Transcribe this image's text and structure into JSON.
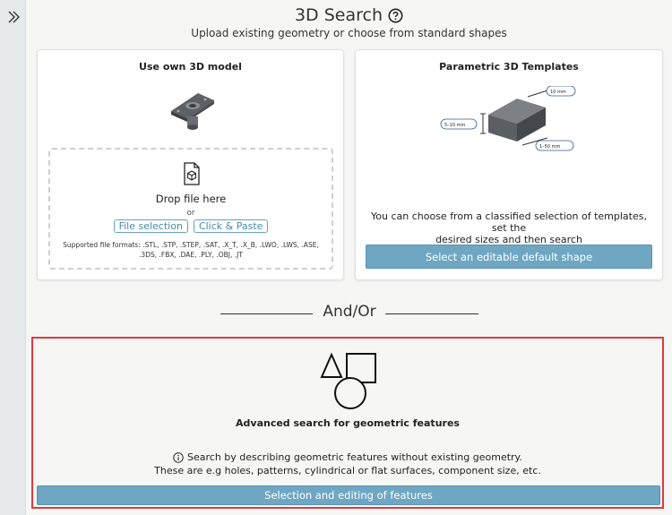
{
  "sidebar": {
    "toggle_icon": "double-chevron-right-icon"
  },
  "header": {
    "title": "3D Search",
    "help_icon": "question-circle-icon",
    "subtitle": "Upload existing geometry or choose from standard shapes"
  },
  "own_model": {
    "title": "Use own 3D model",
    "preview_icon": "3d-part-preview-icon",
    "file_icon": "file-cube-icon",
    "drop_text": "Drop file here",
    "or_text": "or",
    "file_selection_label": "File selection",
    "click_paste_label": "Click & Paste",
    "formats_line1": "Supported file formats: .STL, .STP, .STEP, .SAT, .X_T, .X_B, .LWO, .LWS, .ASE,",
    "formats_line2": ".3DS, .FBX, .DAE, .PLY, .OBJ, .JT"
  },
  "templates": {
    "title": "Parametric 3D Templates",
    "dim_top": "10 mm",
    "dim_left": "5–10 mm",
    "dim_bottom": "1–50 mm",
    "desc_line1": "You can choose from a classified selection of templates, set the",
    "desc_line2": "desired sizes and then search",
    "button_label": "Select an editable default shape"
  },
  "divider": {
    "label": "And/Or"
  },
  "advanced": {
    "shapes_icon": "geometric-shapes-icon",
    "title": "Advanced search for geometric features",
    "info_icon": "info-circle-icon",
    "desc_line1": "Search by describing geometric features without existing geometry.",
    "desc_line2": "These are e.g holes, patterns, cylindrical or flat surfaces, component size, etc.",
    "button_label": "Selection and editing of features"
  },
  "colors": {
    "accent_button": "#6fa7c3",
    "highlight_border": "#e03a3a",
    "link": "#4a8aaa"
  }
}
